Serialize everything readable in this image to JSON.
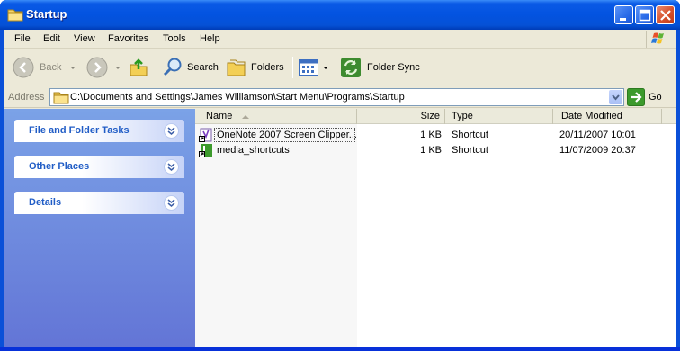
{
  "window": {
    "title": "Startup"
  },
  "menu": [
    "File",
    "Edit",
    "View",
    "Favorites",
    "Tools",
    "Help"
  ],
  "toolbar": {
    "back_label": "Back",
    "search_label": "Search",
    "folders_label": "Folders",
    "folder_sync_label": "Folder Sync"
  },
  "address": {
    "label": "Address",
    "path": "C:\\Documents and Settings\\James Williamson\\Start Menu\\Programs\\Startup",
    "go_label": "Go"
  },
  "tasks": [
    {
      "title": "File and Folder Tasks"
    },
    {
      "title": "Other Places"
    },
    {
      "title": "Details"
    }
  ],
  "columns": {
    "name": "Name",
    "size": "Size",
    "type": "Type",
    "date": "Date Modified"
  },
  "files": [
    {
      "name": "OneNote 2007 Screen Clipper...",
      "size": "1 KB",
      "type": "Shortcut",
      "date": "20/11/2007 10:01",
      "icon": "onenote-shortcut-icon"
    },
    {
      "name": "media_shortcuts",
      "size": "1 KB",
      "type": "Shortcut",
      "date": "11/07/2009 20:37",
      "icon": "media-shortcut-icon"
    }
  ],
  "colors": {
    "titlebar": "#0353e0",
    "taskpane_top": "#7ba2e7",
    "taskpane_bottom": "#6375d6",
    "task_title": "#215dc6"
  }
}
